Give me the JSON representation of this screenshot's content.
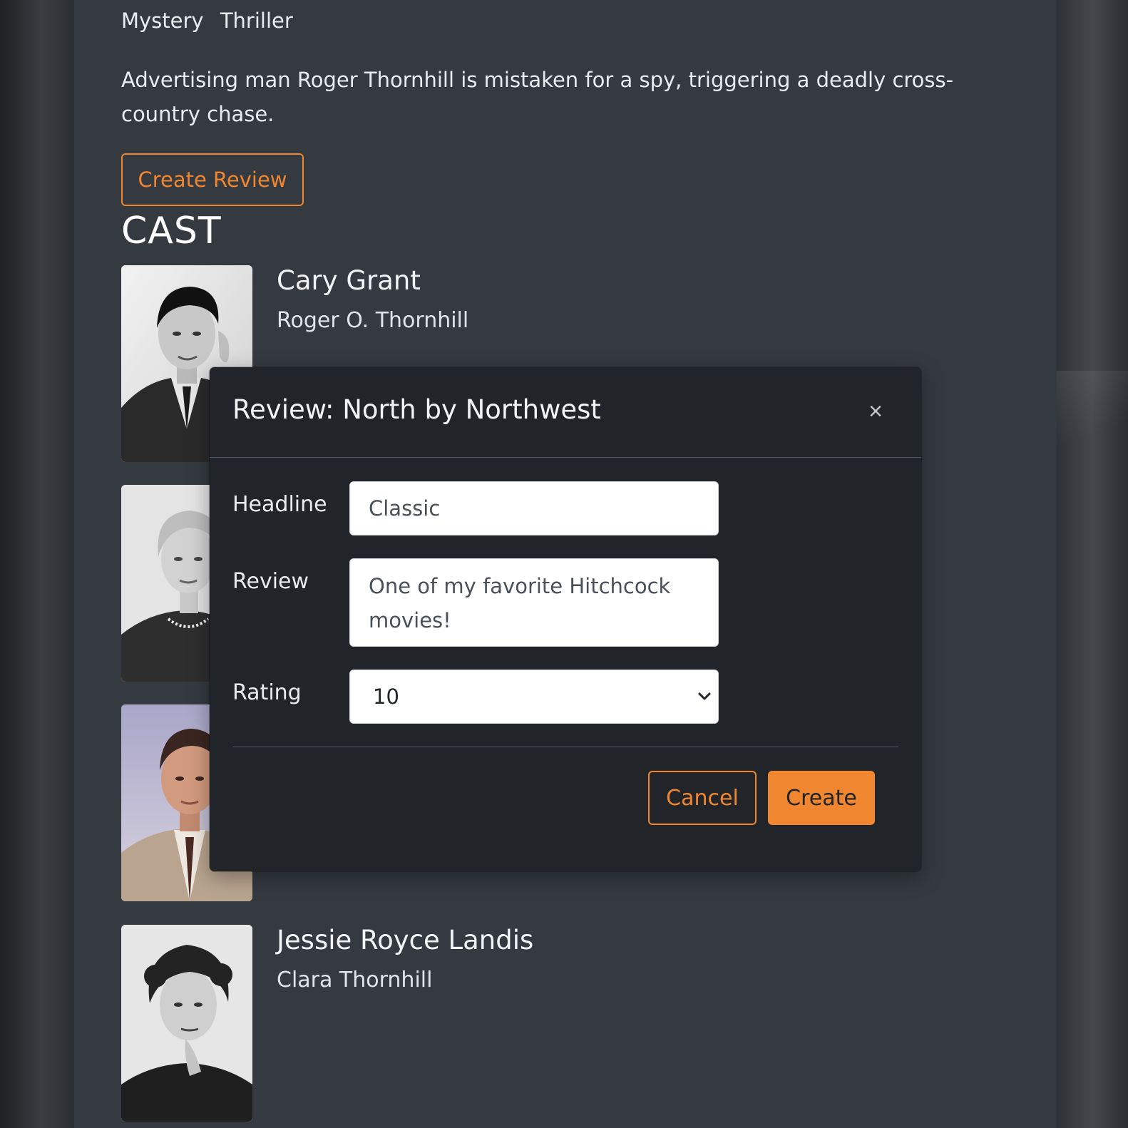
{
  "movie": {
    "genres": [
      "Mystery",
      "Thriller"
    ],
    "synopsis": "Advertising man Roger Thornhill is mistaken for a spy, triggering a deadly cross-country chase.",
    "create_review_label": "Create Review"
  },
  "cast": {
    "title": "CAST",
    "members": [
      {
        "name": "Cary Grant",
        "role": "Roger O. Thornhill"
      },
      {
        "name": "",
        "role": ""
      },
      {
        "name": "",
        "role": ""
      },
      {
        "name": "Jessie Royce Landis",
        "role": "Clara Thornhill"
      }
    ]
  },
  "modal": {
    "title": "Review: North by Northwest",
    "close_glyph": "×",
    "headline_label": "Headline",
    "headline_value": "Classic",
    "review_label": "Review",
    "review_value": "One of my favorite Hitchcock movies!",
    "rating_label": "Rating",
    "rating_value": "10",
    "cancel_label": "Cancel",
    "create_label": "Create"
  },
  "colors": {
    "accent": "#f0862f",
    "page_bg": "#343a40",
    "modal_bg": "#212529"
  }
}
